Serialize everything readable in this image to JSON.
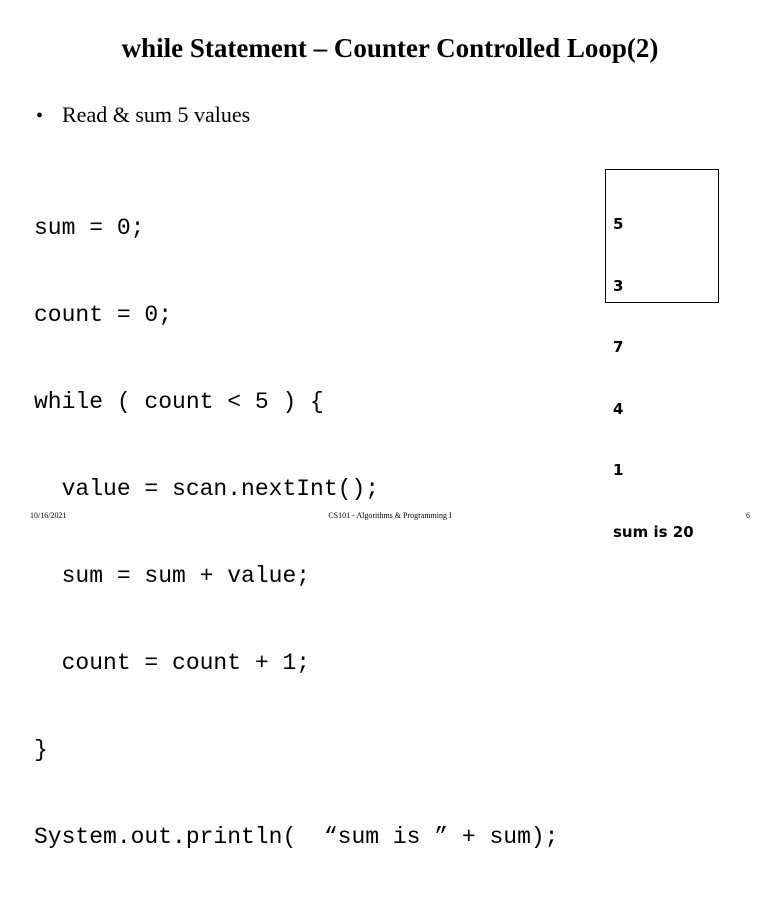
{
  "slide": {
    "title": "while Statement – Counter Controlled Loop(2)",
    "bullets": [
      {
        "marker": "•",
        "text": "Read & sum 5 values"
      }
    ],
    "code_lines": [
      "sum = 0;",
      "count = 0;",
      "while ( count < 5 ) {",
      "  value = scan.nextInt();",
      "  sum = sum + value;",
      "  count = count + 1;",
      "}",
      "System.out.println(  “sum is ” + sum);"
    ],
    "output_box": {
      "lines": [
        "5",
        "3",
        "7",
        "4",
        "1",
        "sum is 20"
      ],
      "border_color": "#000000",
      "background": "#ffffff"
    },
    "footer": {
      "date": "10/16/2021",
      "center": "CS101 - Algorithms & Programming I",
      "page": "6"
    },
    "background": "#ffffff",
    "text_color": "#000000"
  }
}
